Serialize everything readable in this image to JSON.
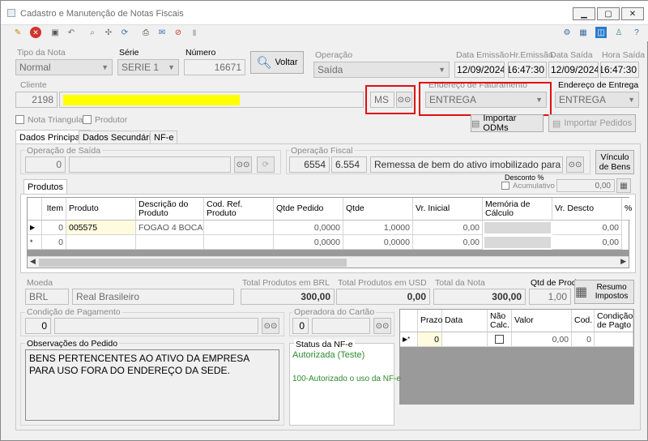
{
  "window": {
    "title": "Cadastro e Manutenção de Notas Fiscais"
  },
  "header": {
    "tipo_nota_label": "Tipo da Nota",
    "tipo_nota": "Normal",
    "serie_label": "Série",
    "serie": "SERIE 1",
    "numero_label": "Número",
    "numero": "16671",
    "voltar_label": "Voltar",
    "operacao_label": "Operação",
    "operacao": "Saída",
    "data_emissao_label": "Data Emissão",
    "data_emissao": "12/09/2024",
    "hr_emissao_label": "Hr.Emissão",
    "hr_emissao": "16:47:30",
    "data_saida_label": "Data Saída",
    "data_saida": "12/09/2024",
    "hora_saida_label": "Hora Saída",
    "hora_saida": "16:47:30"
  },
  "cliente": {
    "label": "Cliente",
    "codigo": "2198",
    "nome": "",
    "uf": "MS",
    "endereco_faturamento_label": "Endereço de Faturamento",
    "endereco_faturamento": "ENTREGA",
    "endereco_entrega_label": "Endereço de Entrega",
    "endereco_entrega": "ENTREGA",
    "nota_triangular_label": "Nota Triangular",
    "produtor_label": "Produtor",
    "importar_odms_label": "Importar ODMs",
    "importar_pedidos_label": "Importar Pedidos"
  },
  "tabs": [
    "Dados Principais",
    "Dados Secundários",
    "NF-e"
  ],
  "dados": {
    "operacao_saida_label": "Operação de Saída",
    "operacao_saida": "0",
    "operacao_fiscal_label": "Operação Fiscal",
    "cfop_codigo": "6554",
    "cfop": "6.554",
    "cfop_descricao": "Remessa de bem do ativo imobilizado para u",
    "vinculo_bens_label": "Vínculo de Bens"
  },
  "produtos": {
    "tab_label": "Produtos",
    "desconto_label": "Desconto %",
    "acumulativo_label": "Acumulativo",
    "desconto_valor": "0,00",
    "columns": [
      "Item",
      "Produto",
      "Descrição do Produto",
      "Cod. Ref. Produto",
      "Qtde Pedido",
      "Qtde",
      "Vr. Inicial",
      "Memória de Cálculo",
      "Vr. Descto",
      "%"
    ],
    "rows": [
      {
        "indicator": "▶",
        "item": "0",
        "produto": "005575",
        "descricao": "FOGAO 4 BOCAS",
        "codref": "",
        "qtde_pedido": "0,0000",
        "qtde": "1,0000",
        "vr_inicial": "0,00",
        "memoria": "",
        "vr_descto": "0,00"
      },
      {
        "indicator": "*",
        "item": "0",
        "produto": "",
        "descricao": "",
        "codref": "",
        "qtde_pedido": "0,0000",
        "qtde": "0,0000",
        "vr_inicial": "0,00",
        "memoria": "",
        "vr_descto": "0,00"
      }
    ]
  },
  "totais": {
    "moeda_label": "Moeda",
    "moeda_codigo": "BRL",
    "moeda_nome": "Real Brasileiro",
    "total_brl_label": "Total Produtos em BRL",
    "total_brl": "300,00",
    "total_usd_label": "Total Produtos em USD",
    "total_usd": "0,00",
    "total_nota_label": "Total da Nota",
    "total_nota": "300,00",
    "qtd_prod_label": "Qtd de Prod.",
    "qtd_prod": "1,00",
    "resumo_impostos_label": "Resumo Impostos"
  },
  "pagamento": {
    "condicao_label": "Condição de Pagamento",
    "condicao": "0",
    "operadora_label": "Operadora do Cartão",
    "operadora": "0",
    "columns": [
      "Prazo",
      "Data",
      "Não Calc.",
      "Valor",
      "Cod.",
      "Condição de Pagto"
    ],
    "row": {
      "indicator": "▶*",
      "prazo": "0",
      "data": "",
      "valor": "0,00",
      "cod": "0",
      "condicao": ""
    }
  },
  "observacoes": {
    "label": "Observações do Pedido",
    "texto": "BENS PERTENCENTES AO ATIVO DA EMPRESA PARA USO FORA DO ENDEREÇO DA SEDE."
  },
  "status_nfe": {
    "label": "Status da NF-e",
    "status": "Autorizada (Teste)",
    "mensagem": "100-Autorizado o uso da NF-e"
  }
}
